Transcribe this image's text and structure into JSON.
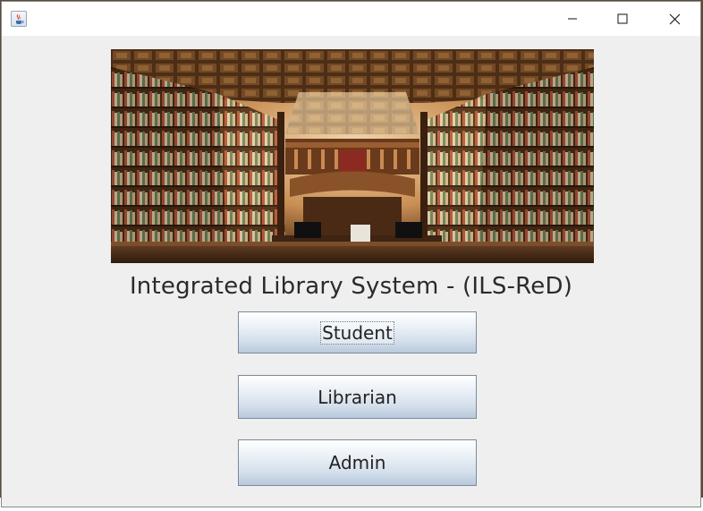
{
  "window": {
    "title": "",
    "controls": {
      "minimize": "minimize-icon",
      "maximize": "maximize-icon",
      "close": "close-icon"
    }
  },
  "hero": {
    "image": "library-interior-photo"
  },
  "main": {
    "title": "Integrated Library System - (ILS-ReD)"
  },
  "buttons": {
    "student": "Student",
    "librarian": "Librarian",
    "admin": "Admin"
  },
  "colors": {
    "window_bg": "#efefef",
    "titlebar_bg": "#ffffff",
    "button_gradient_top": "#ffffff",
    "button_gradient_bottom": "#b8c9dc",
    "button_border": "#7a8a9c"
  }
}
